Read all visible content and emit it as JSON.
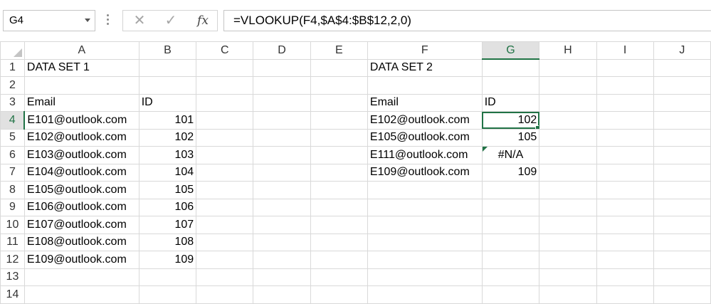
{
  "name_box": {
    "value": "G4"
  },
  "formula_bar": {
    "cancel_glyph": "✕",
    "enter_glyph": "✓",
    "fx_label": "fx",
    "formula": "=VLOOKUP(F4,$A$4:$B$12,2,0)"
  },
  "columns": [
    "A",
    "B",
    "C",
    "D",
    "E",
    "F",
    "G",
    "H",
    "I",
    "J"
  ],
  "rows": [
    "1",
    "2",
    "3",
    "4",
    "5",
    "6",
    "7",
    "8",
    "9",
    "10",
    "11",
    "12",
    "13",
    "14"
  ],
  "cells": {
    "A1": "DATA SET 1",
    "F1": "DATA SET 2",
    "A3": "Email",
    "B3": "ID",
    "F3": "Email",
    "G3": "ID",
    "A4": "E101@outlook.com",
    "B4": "101",
    "A5": "E102@outlook.com",
    "B5": "102",
    "A6": "E103@outlook.com",
    "B6": "103",
    "A7": "E104@outlook.com",
    "B7": "104",
    "A8": "E105@outlook.com",
    "B8": "105",
    "A9": "E106@outlook.com",
    "B9": "106",
    "A10": "E107@outlook.com",
    "B10": "107",
    "A11": "E108@outlook.com",
    "B11": "108",
    "A12": "E109@outlook.com",
    "B12": "109",
    "F4": "E102@outlook.com",
    "G4": "102",
    "F5": "E105@outlook.com",
    "G5": "105",
    "F6": "E111@outlook.com",
    "G6": "#N/A",
    "F7": "E109@outlook.com",
    "G7": "109"
  },
  "active_cell": "G4",
  "colors": {
    "accent": "#217346",
    "gridline": "#d9d9d9",
    "header_active_bg": "#e1e1e1"
  }
}
